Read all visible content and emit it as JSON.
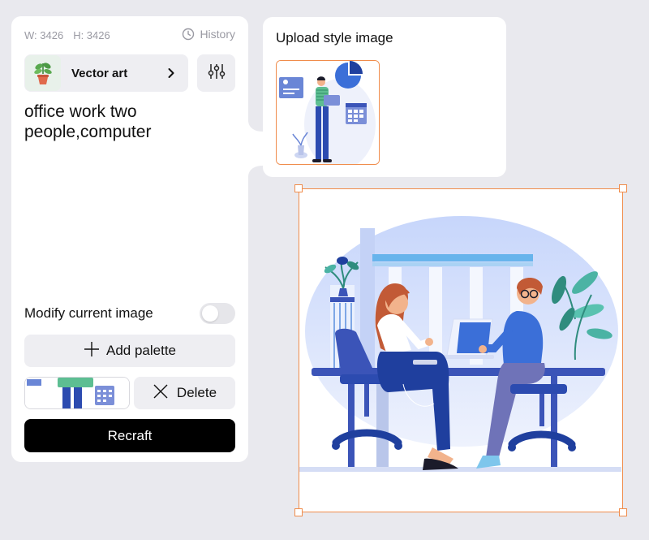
{
  "left_panel": {
    "width_label": "W: 3426",
    "height_label": "H: 3426",
    "history_label": "History",
    "style": {
      "label": "Vector art",
      "icon": "potted-plant-icon"
    },
    "prompt_text": "office work two people,computer",
    "modify_label": "Modify current image",
    "modify_enabled": false,
    "add_palette_label": "Add palette",
    "delete_label": "Delete",
    "recraft_label": "Recraft"
  },
  "upload_panel": {
    "title": "Upload style image"
  },
  "colors": {
    "accent": "#f08c4b",
    "primary_button": "#000000",
    "panel_bg": "#ffffff",
    "page_bg": "#e9e9ee",
    "illustration_blue": "#2c4bb0",
    "illustration_light": "#dfe7fb"
  }
}
